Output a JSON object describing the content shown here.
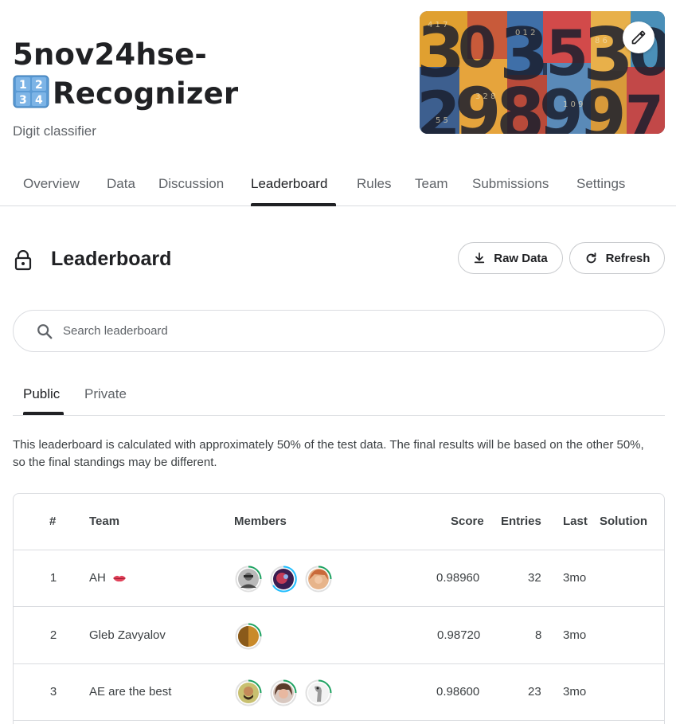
{
  "header": {
    "title_line1": "5nov24hse-",
    "title_line2": "Recognizer",
    "title_emoji": "1234-keycap-icon",
    "subtitle": "Digit classifier",
    "banner": "numbers-collage-image",
    "edit_icon": "pencil-icon"
  },
  "tabs": [
    {
      "label": "Overview"
    },
    {
      "label": "Data"
    },
    {
      "label": "Discussion"
    },
    {
      "label": "Leaderboard",
      "active": true
    },
    {
      "label": "Rules"
    },
    {
      "label": "Team"
    },
    {
      "label": "Submissions"
    },
    {
      "label": "Settings"
    }
  ],
  "leaderboard": {
    "title": "Leaderboard",
    "lock_icon": "lock-icon",
    "raw_data_label": "Raw Data",
    "refresh_label": "Refresh",
    "search_placeholder": "Search leaderboard",
    "subtabs": [
      {
        "label": "Public",
        "active": true
      },
      {
        "label": "Private"
      }
    ],
    "note": "This leaderboard is calculated with approximately 50% of the test data. The final results will be based on the other 50%, so the final standings may be different."
  },
  "table": {
    "headers": {
      "rank": "#",
      "team": "Team",
      "members": "Members",
      "score": "Score",
      "entries": "Entries",
      "last": "Last",
      "solution": "Solution"
    },
    "rows": [
      {
        "rank": "1",
        "team": "AH",
        "team_emoji": "lips-icon",
        "members": [
          "avatar-1a",
          "avatar-1b",
          "avatar-1c"
        ],
        "score": "0.98960",
        "entries": "32",
        "last": "3mo"
      },
      {
        "rank": "2",
        "team": "Gleb Zavyalov",
        "members": [
          "avatar-2a"
        ],
        "score": "0.98720",
        "entries": "8",
        "last": "3mo"
      },
      {
        "rank": "3",
        "team": "AE are the best",
        "members": [
          "avatar-3a",
          "avatar-3b",
          "avatar-3c"
        ],
        "score": "0.98600",
        "entries": "23",
        "last": "3mo"
      }
    ]
  },
  "colors": {
    "text": "#202124",
    "muted": "#5f6368",
    "border": "#dadce0",
    "tier_green": "#20beff",
    "ring_green": "#1ea362"
  }
}
